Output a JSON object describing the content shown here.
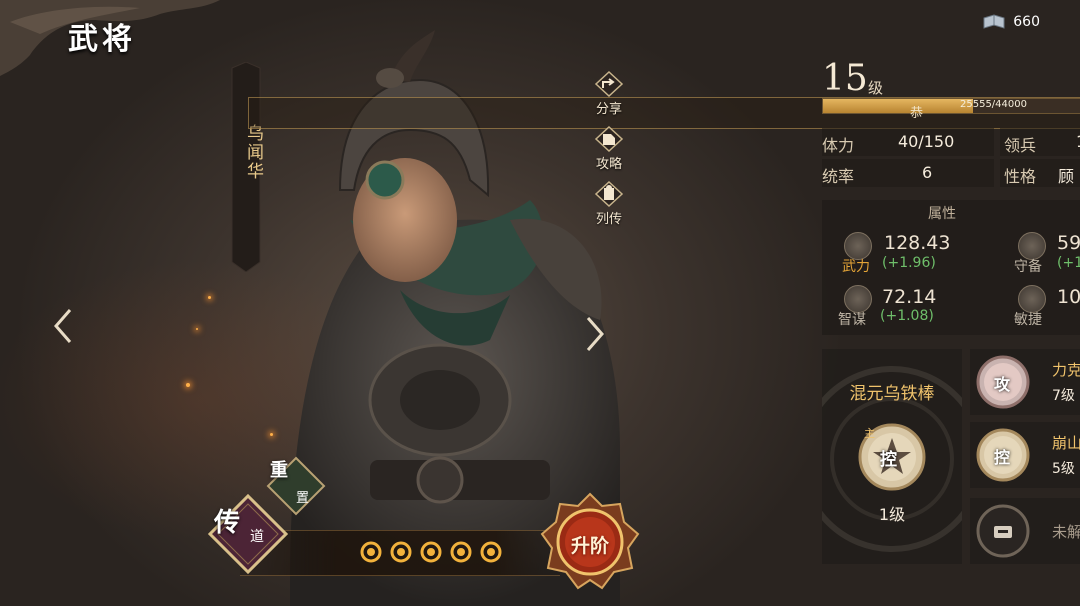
{
  "title": "武将",
  "currency": {
    "icon": "book-icon",
    "value": "660"
  },
  "hero": {
    "name": "乌闻华"
  },
  "tools": [
    {
      "label": "分享",
      "icon": "share-icon"
    },
    {
      "label": "攻略",
      "icon": "guide-icon"
    },
    {
      "label": "列传",
      "icon": "biography-icon"
    }
  ],
  "level": {
    "value": "15",
    "unit": "级"
  },
  "xp": {
    "label": "恭",
    "text": "25555/44000",
    "progress": 0.58
  },
  "stats": {
    "stamina_label": "体力",
    "stamina_value": "40/150",
    "troops_label": "领兵",
    "troops_value": "1",
    "command_label": "统率",
    "command_value": "6",
    "personality_label": "性格",
    "personality_value": "顾"
  },
  "attributes": {
    "title": "属性",
    "items": [
      {
        "name": "武力",
        "value": "128.43",
        "bonus": "(+1.96)",
        "icon": "sword-icon",
        "color": "#e4a437"
      },
      {
        "name": "守备",
        "value": "59",
        "bonus": "(+1",
        "icon": "shield-icon",
        "color": "#bdb3a4"
      },
      {
        "name": "智谋",
        "value": "72.14",
        "bonus": "(+1.08)",
        "icon": "book-icon",
        "color": "#bdb3a4"
      },
      {
        "name": "敏捷",
        "value": "10",
        "bonus": "",
        "icon": "boot-icon",
        "color": "#bdb3a4"
      }
    ]
  },
  "weapon": {
    "name": "混元乌铁棒",
    "badge": "主",
    "type": "控",
    "level": "1级"
  },
  "skills": [
    {
      "name": "力克",
      "level": "7级",
      "type": "攻",
      "locked": false
    },
    {
      "name": "崩山",
      "level": "5级",
      "type": "控",
      "locked": false
    },
    {
      "name": "未解",
      "level": "",
      "type": "",
      "locked": true
    }
  ],
  "actions": {
    "pass_label": "传",
    "pass_sub": "道",
    "reset_label": "重",
    "reset_sub": "置",
    "upgrade_label": "升阶"
  },
  "stars": {
    "count": 5,
    "color": "#f2b23c"
  },
  "colors": {
    "accent": "#f0c36c",
    "bonus": "#6fbf6a",
    "panel": "#1e1916"
  }
}
